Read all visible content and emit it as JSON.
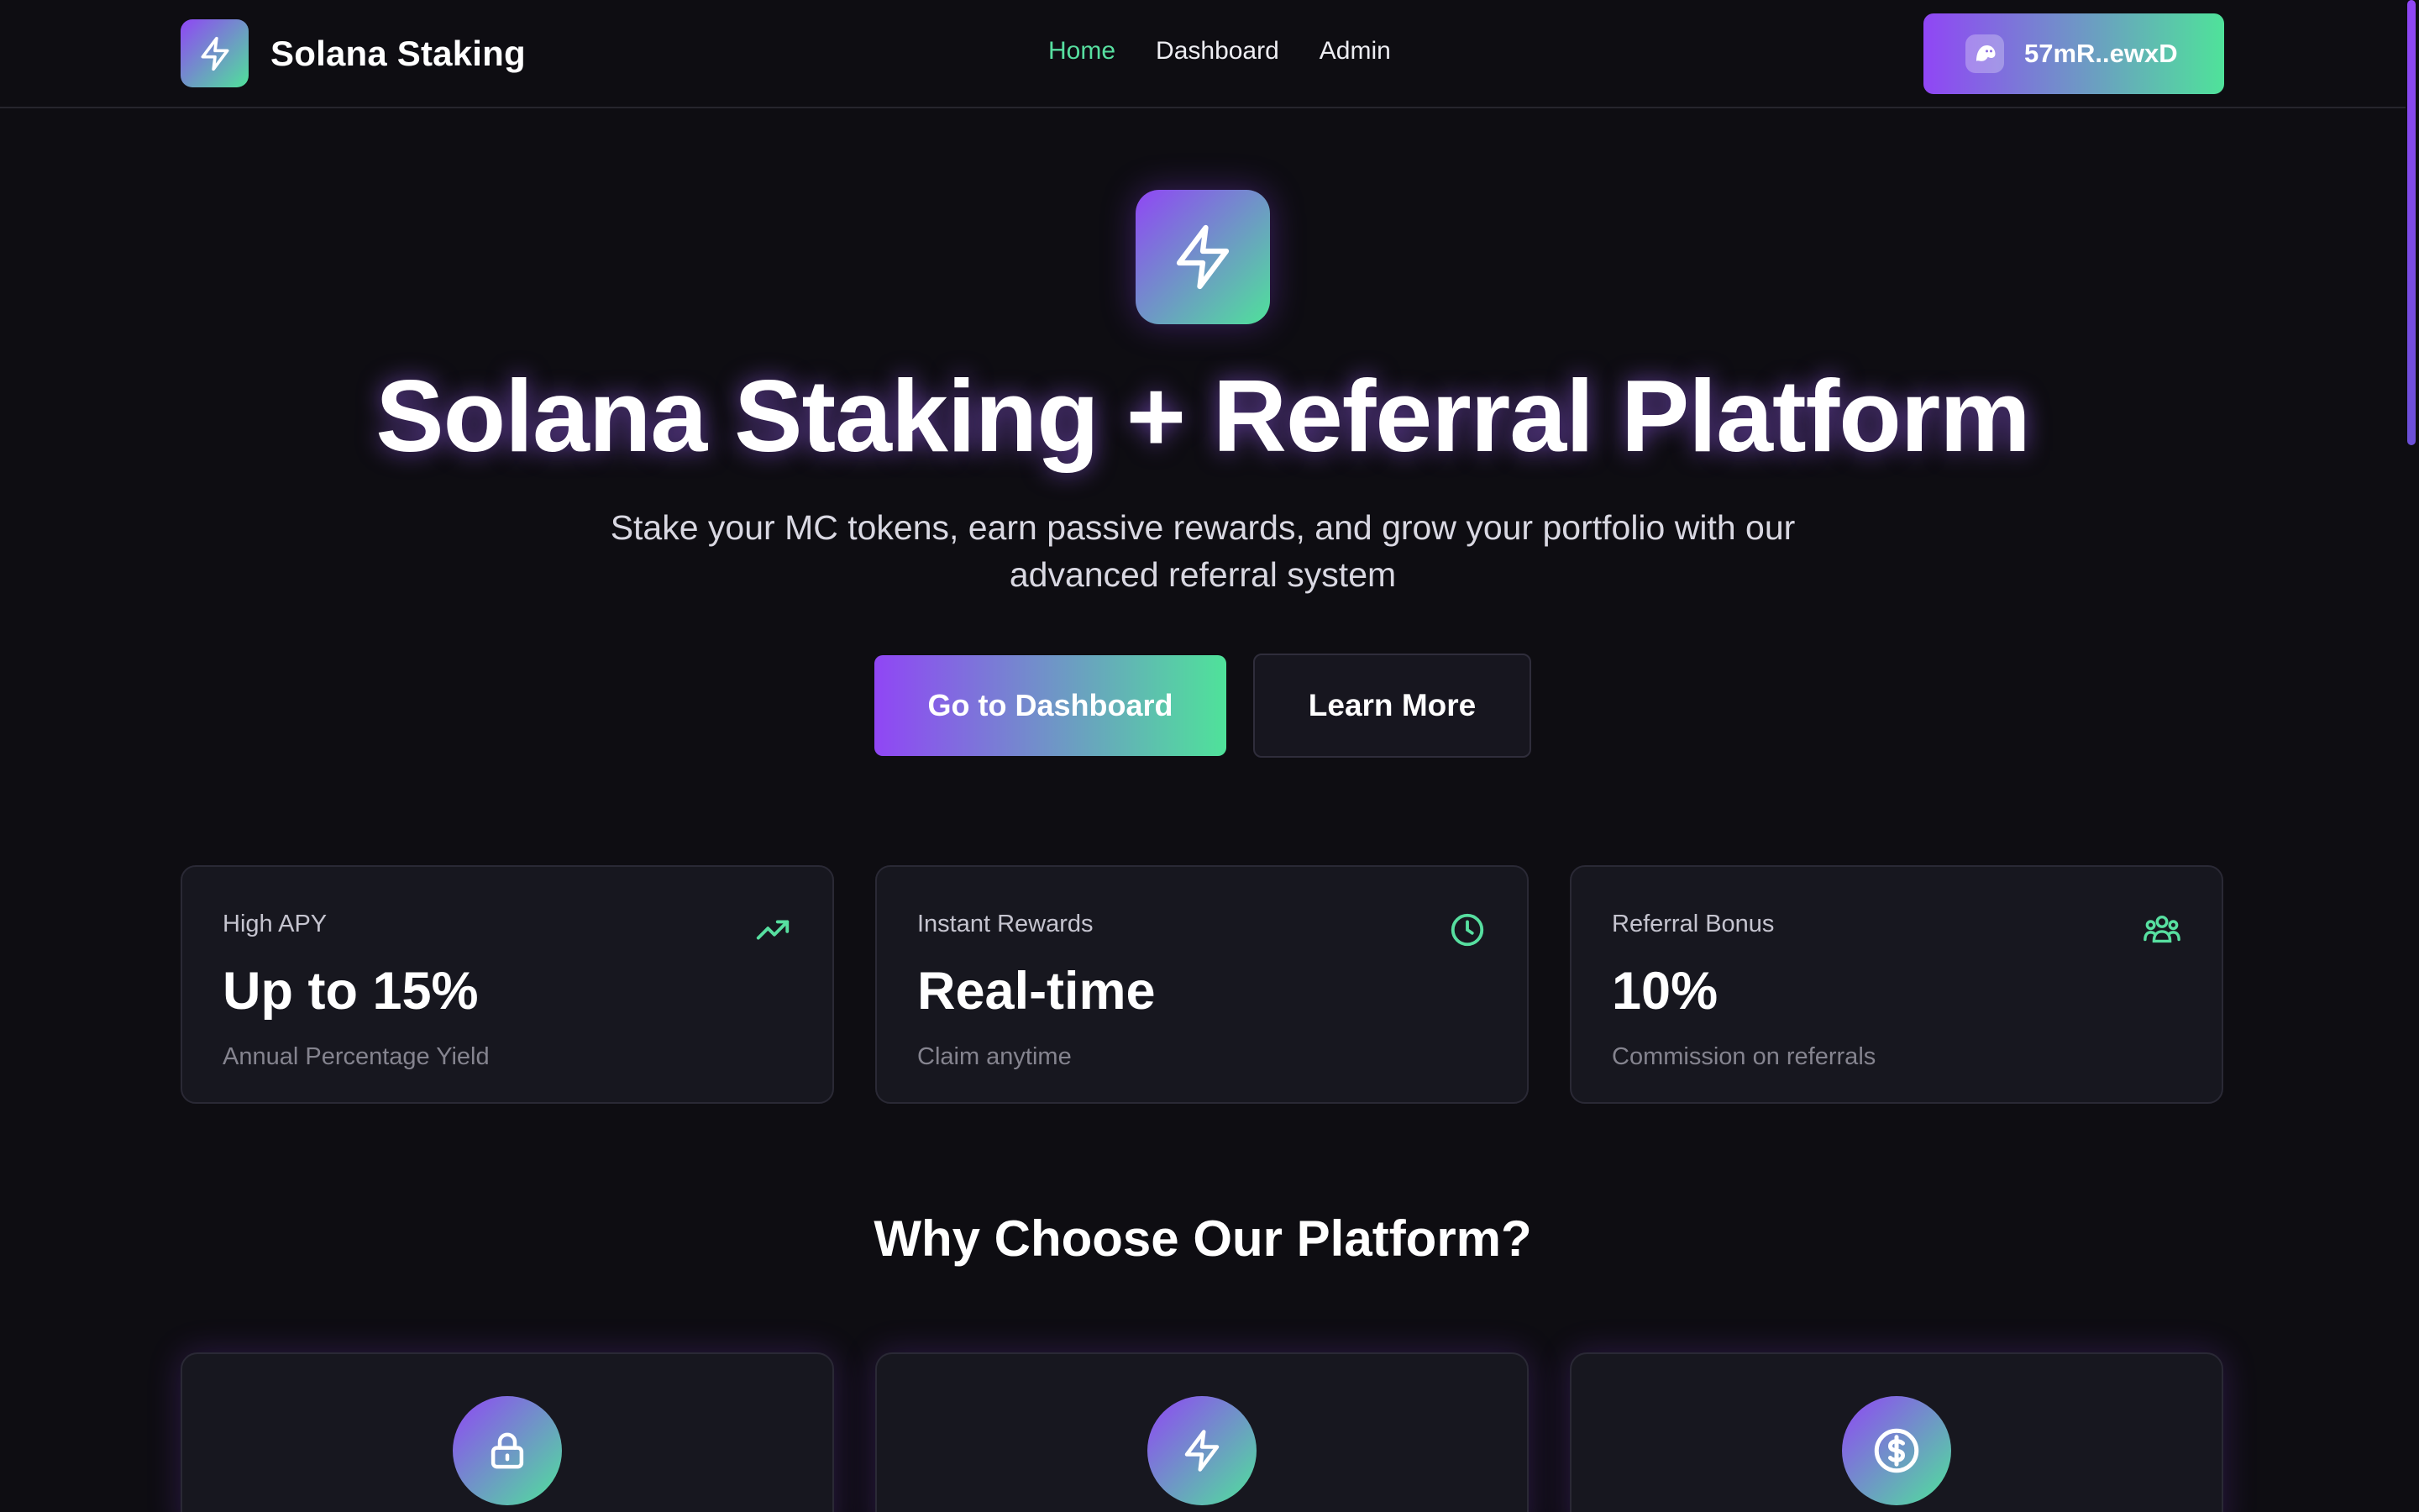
{
  "navbar": {
    "brand_title": "Solana Staking",
    "links": [
      {
        "label": "Home",
        "active": true
      },
      {
        "label": "Dashboard",
        "active": false
      },
      {
        "label": "Admin",
        "active": false
      }
    ],
    "wallet_label": "57mR..ewxD"
  },
  "hero": {
    "title": "Solana Staking + Referral Platform",
    "subtitle": "Stake your MC tokens, earn passive rewards, and grow your portfolio with our advanced referral system",
    "primary_button": "Go to Dashboard",
    "secondary_button": "Learn More"
  },
  "stats": [
    {
      "label": "High APY",
      "value": "Up to 15%",
      "caption": "Annual Percentage Yield",
      "icon": "trending-up-icon"
    },
    {
      "label": "Instant Rewards",
      "value": "Real-time",
      "caption": "Claim anytime",
      "icon": "clock-icon"
    },
    {
      "label": "Referral Bonus",
      "value": "10%",
      "caption": "Commission on referrals",
      "icon": "users-icon"
    }
  ],
  "features": {
    "title": "Why Choose Our Platform?",
    "icons": [
      "lock-icon",
      "lightning-icon",
      "dollar-icon"
    ]
  },
  "colors": {
    "accent_purple": "#9046f5",
    "accent_green": "#4fe29a",
    "nav_active": "#57dfa0",
    "background": "#0e0d12",
    "card": "#17171f"
  }
}
